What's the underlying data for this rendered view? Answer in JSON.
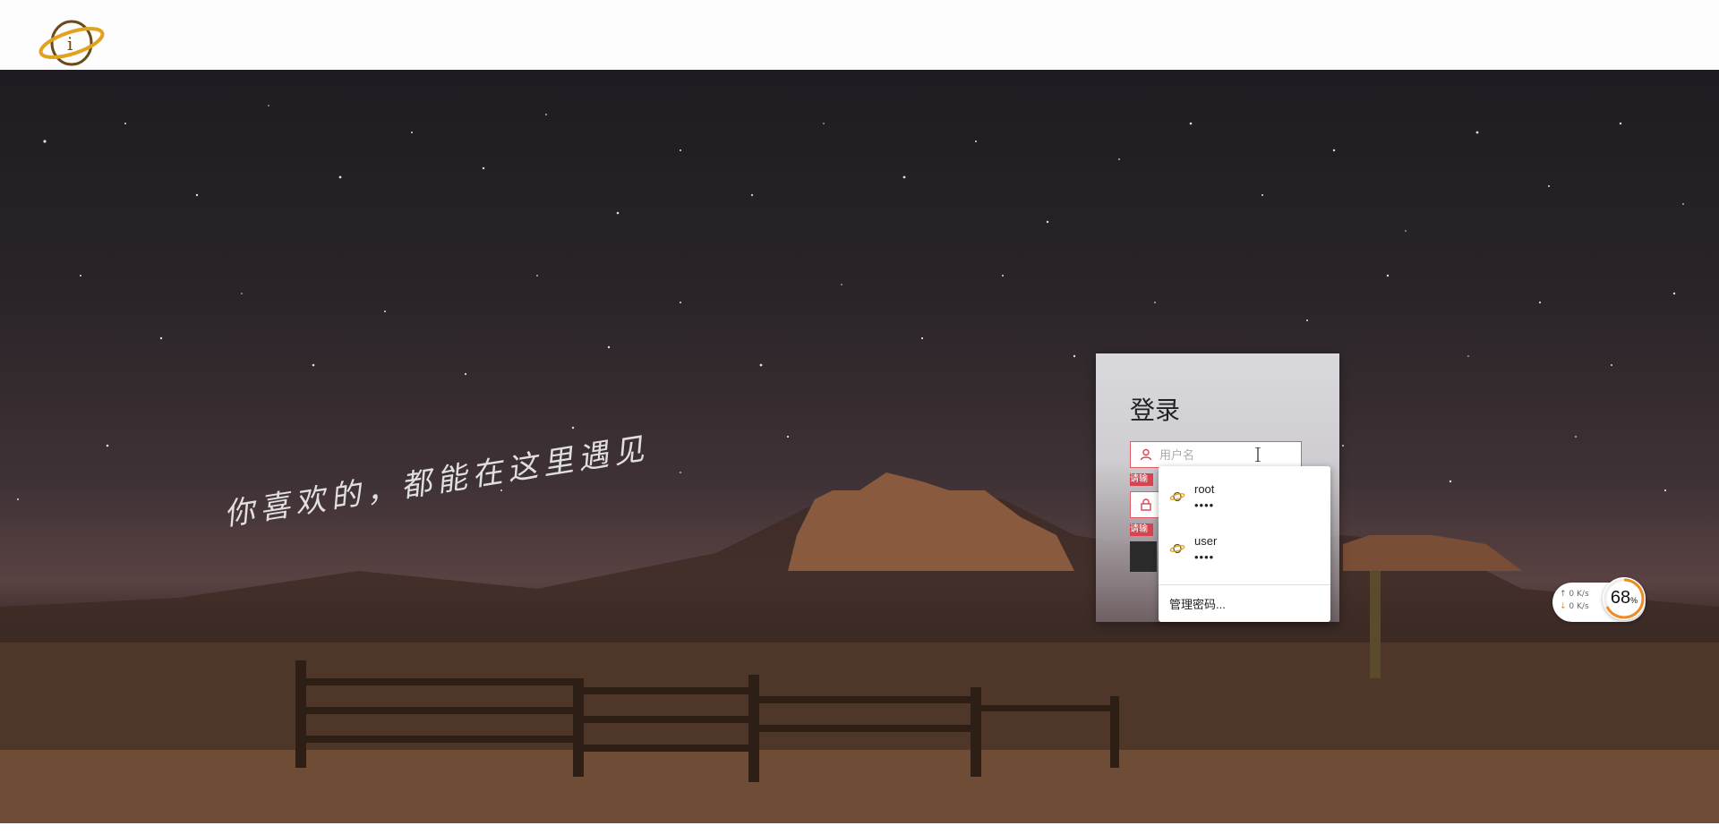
{
  "header": {
    "logo_icon": "saturn-planet-logo"
  },
  "hero": {
    "tagline": "你喜欢的，都能在这里遇见"
  },
  "login": {
    "title": "登录",
    "username_placeholder": "用户名",
    "username_value": "",
    "password_placeholder": "",
    "error_label_1": "请输",
    "error_label_2": "请输",
    "submit_label": ""
  },
  "autofill": {
    "items": [
      {
        "username": "root",
        "password_mask": "••••"
      },
      {
        "username": "user",
        "password_mask": "••••"
      }
    ],
    "manage_label": "管理密码..."
  },
  "network_widget": {
    "upload": "0",
    "upload_unit": "K/s",
    "download": "0",
    "download_unit": "K/s",
    "percent": "68",
    "percent_sign": "%",
    "accent_color": "#f08a24"
  }
}
